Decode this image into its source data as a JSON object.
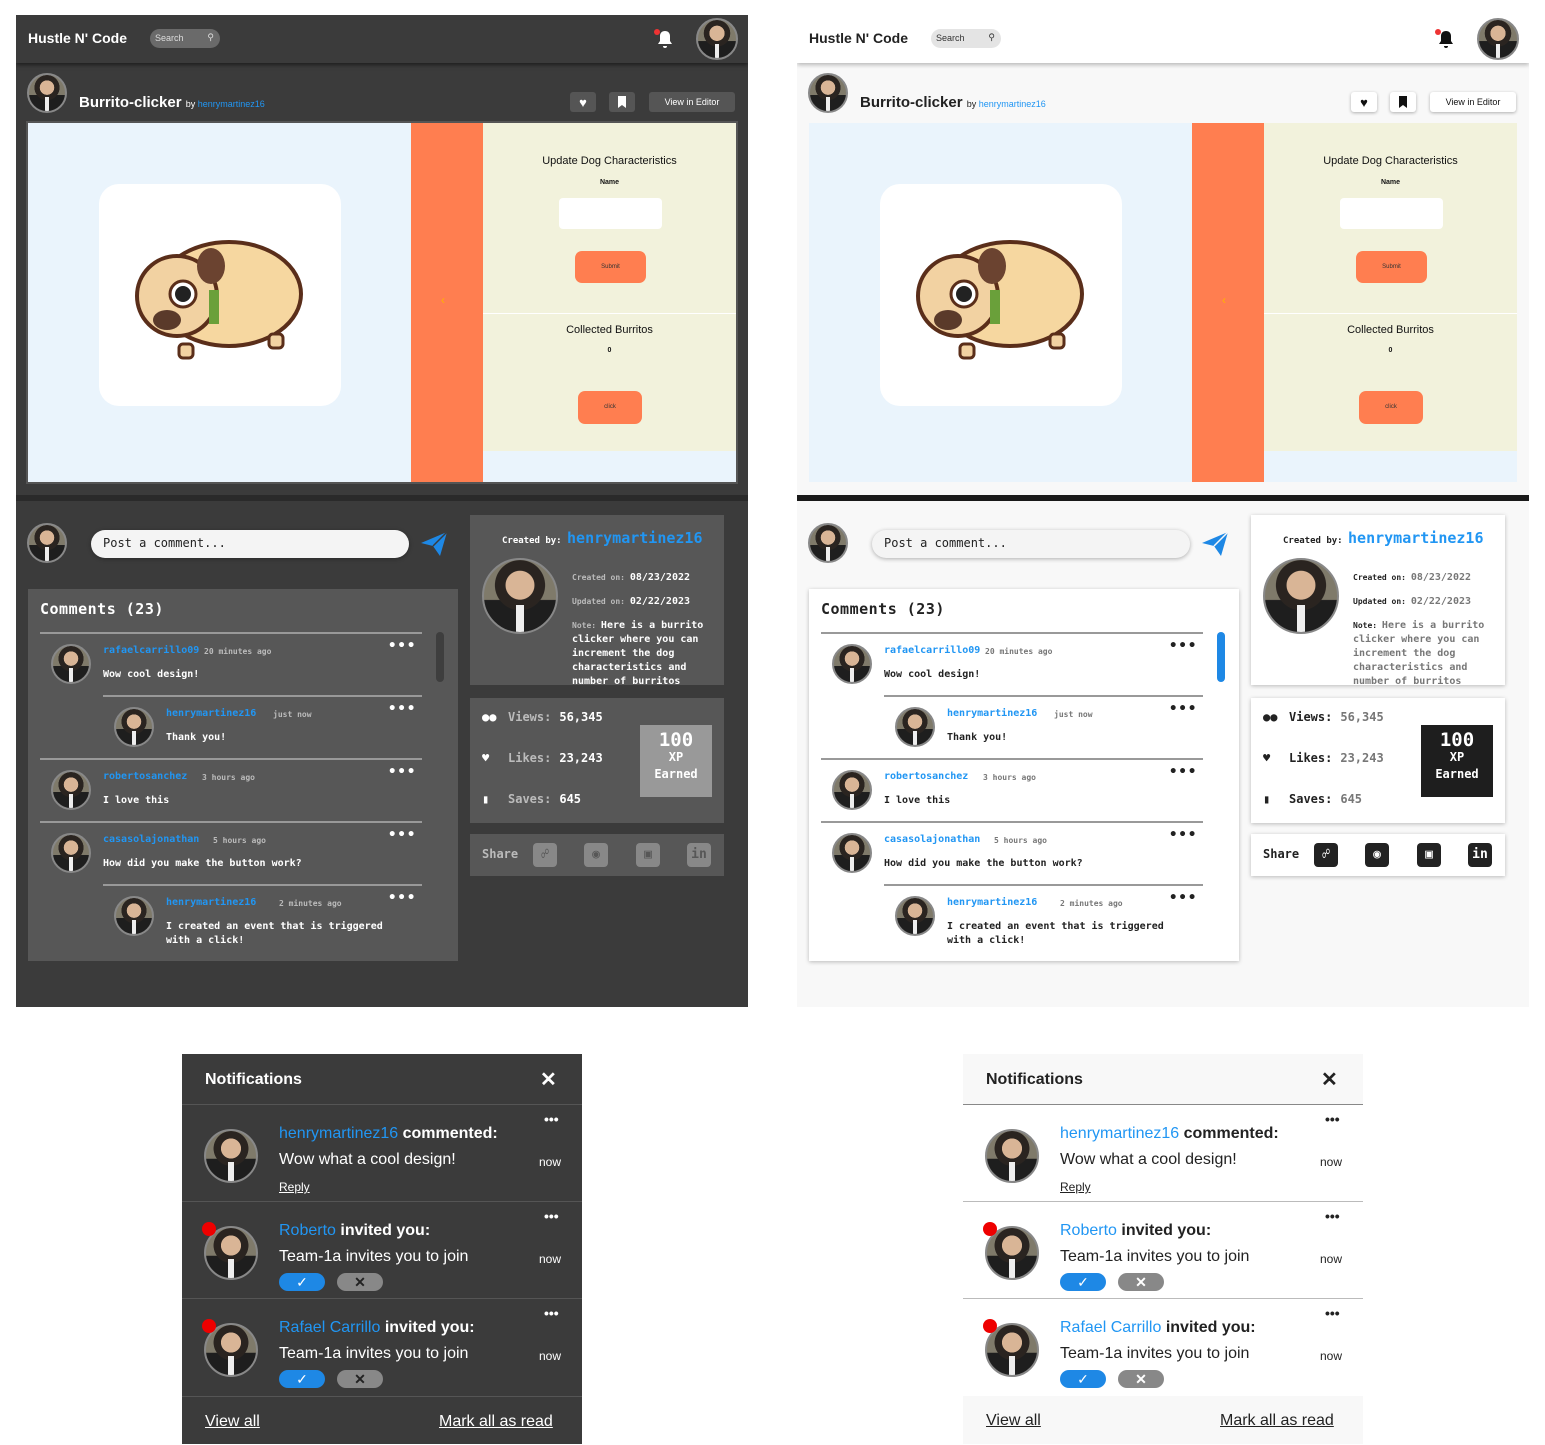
{
  "app": {
    "logo": "Hustle N' Code",
    "search_placeholder": "Search"
  },
  "project": {
    "title": "Burrito-clicker",
    "by": "by",
    "author": "henrymartinez16",
    "view_in_editor": "View in Editor"
  },
  "preview": {
    "form_title": "Update Dog Characteristics",
    "name_label": "Name",
    "submit_label": "Submit",
    "collected_title": "Collected Burritos",
    "collected_value": "0",
    "click_label": "click",
    "arrow": "‹"
  },
  "comments": {
    "post_placeholder": "Post a comment...",
    "title": "Comments (23)",
    "items": [
      {
        "user": "rafaelcarrillo09",
        "time": "20 minutes ago",
        "text": "Wow cool design!"
      },
      {
        "user": "henrymartinez16",
        "time": "just now",
        "text": "Thank you!"
      },
      {
        "user": "robertosanchez",
        "time": "3 hours ago",
        "text": "I love this"
      },
      {
        "user": "casasolajonathan",
        "time": "5 hours ago",
        "text": "How did you make the button work?"
      },
      {
        "user": "henrymartinez16",
        "time": "2 minutes ago",
        "text": "I created an event that is triggered with a click!"
      }
    ],
    "dots": "•••"
  },
  "info": {
    "created_by_label": "Created by:",
    "created_by": "henrymartinez16",
    "created_on_label": "Created on:",
    "created_on": "08/23/2022",
    "updated_on_label": "Updated on:",
    "updated_on": "02/22/2023",
    "note_label": "Note:",
    "note": "Here is a burrito clicker where you can increment the dog characteristics and number of burritos"
  },
  "stats": {
    "views_label": "Views:",
    "views": "56,345",
    "likes_label": "Likes:",
    "likes": "23,243",
    "saves_label": "Saves:",
    "saves": "645",
    "xp_value": "100",
    "xp_unit": "XP",
    "xp_label": "Earned"
  },
  "share": {
    "label": "Share",
    "icons": [
      "link-icon",
      "github-icon",
      "instagram-icon",
      "linkedin-icon"
    ]
  },
  "notifications": {
    "title": "Notifications",
    "close": "✕",
    "items": [
      {
        "user": "henrymartinez16",
        "action": "commented:",
        "message": "Wow what a cool design!",
        "time": "now",
        "reply": "Reply"
      },
      {
        "user": "Roberto",
        "action": "invited you:",
        "message": "Team-1a invites you to join",
        "time": "now"
      },
      {
        "user": "Rafael Carrillo",
        "action": "invited you:",
        "message": "Team-1a invites you to join",
        "time": "now"
      }
    ],
    "dots": "•••",
    "view_all": "View all",
    "mark_all": "Mark all as read"
  },
  "colors": {
    "accent": "#2196f3",
    "orange": "#ff7e50",
    "dark_bg": "#3b3b3b",
    "light_bg": "#f8f8f8"
  }
}
